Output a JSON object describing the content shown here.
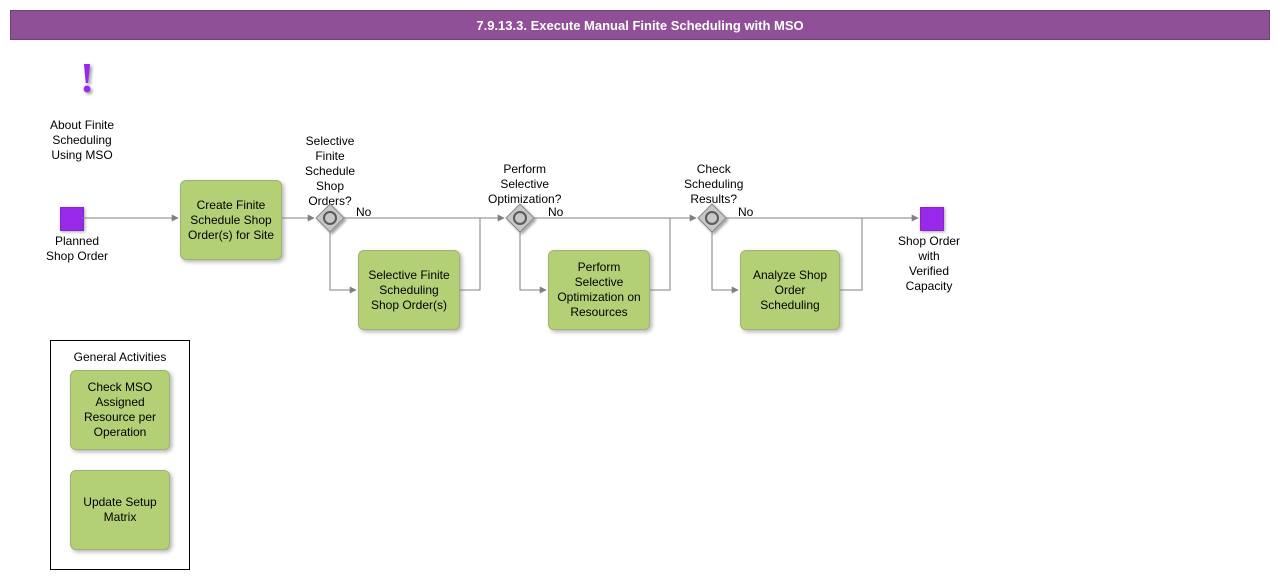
{
  "colors": {
    "titlebar_bg": "#8f5097",
    "activity_bg": "#b4d077",
    "start_end": "#9929ea",
    "exclaim": "#9929ea",
    "gateway_fill": "#c7c7c7",
    "gateway_stroke": "#878787"
  },
  "titlebar": {
    "text": "7.9.13.3. Execute Manual Finite Scheduling with MSO"
  },
  "info": {
    "label": "About Finite\nScheduling\nUsing MSO"
  },
  "start": {
    "label": "Planned\nShop Order"
  },
  "end": {
    "label": "Shop Order\nwith\nVerified\nCapacity"
  },
  "activities": {
    "create": "Create Finite Schedule Shop Order(s) for Site",
    "selective_path": "Selective Finite Scheduling Shop Order(s)",
    "optimize_path": "Perform Selective Optimization on Resources",
    "analyze_path": "Analyze Shop Order Scheduling"
  },
  "gateways": {
    "g1": {
      "label": "Selective\nFinite\nSchedule\nShop\nOrders?",
      "no": "No"
    },
    "g2": {
      "label": "Perform\nSelective\nOptimization?",
      "no": "No"
    },
    "g3": {
      "label": "Check\nScheduling\nResults?",
      "no": "No"
    }
  },
  "general": {
    "title": "General Activities",
    "a1": "Check MSO Assigned Resource per Operation",
    "a2": "Update Setup Matrix"
  }
}
